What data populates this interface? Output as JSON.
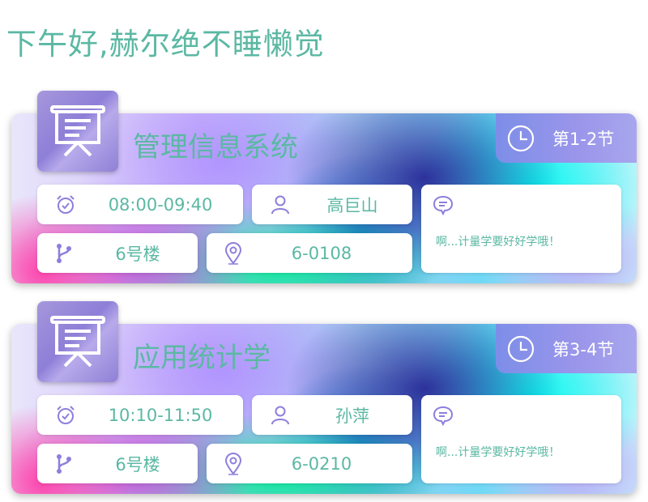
{
  "greeting": "下午好,赫尔绝不睡懒觉",
  "courses": [
    {
      "title": "管理信息系统",
      "period": "第1-2节",
      "time": "08:00-09:40",
      "teacher": "高巨山",
      "building": "6号楼",
      "room": "6-0108",
      "note": "啊...计量学要好好学哦！"
    },
    {
      "title": "应用统计学",
      "period": "第3-4节",
      "time": "10:10-11:50",
      "teacher": "孙萍",
      "building": "6号楼",
      "room": "6-0210",
      "note": "啊...计量学要好好学哦！"
    }
  ],
  "icons": {
    "course": "presentation-board-icon",
    "period": "clock-icon",
    "time": "alarm-clock-icon",
    "teacher": "person-icon",
    "building": "branch-icon",
    "room": "location-pin-icon",
    "note": "chat-bubble-icon"
  },
  "colors": {
    "text_accent": "#5bb8a3",
    "icon_purple": "#8d7fdc",
    "period_bg": "#8e91ea"
  }
}
